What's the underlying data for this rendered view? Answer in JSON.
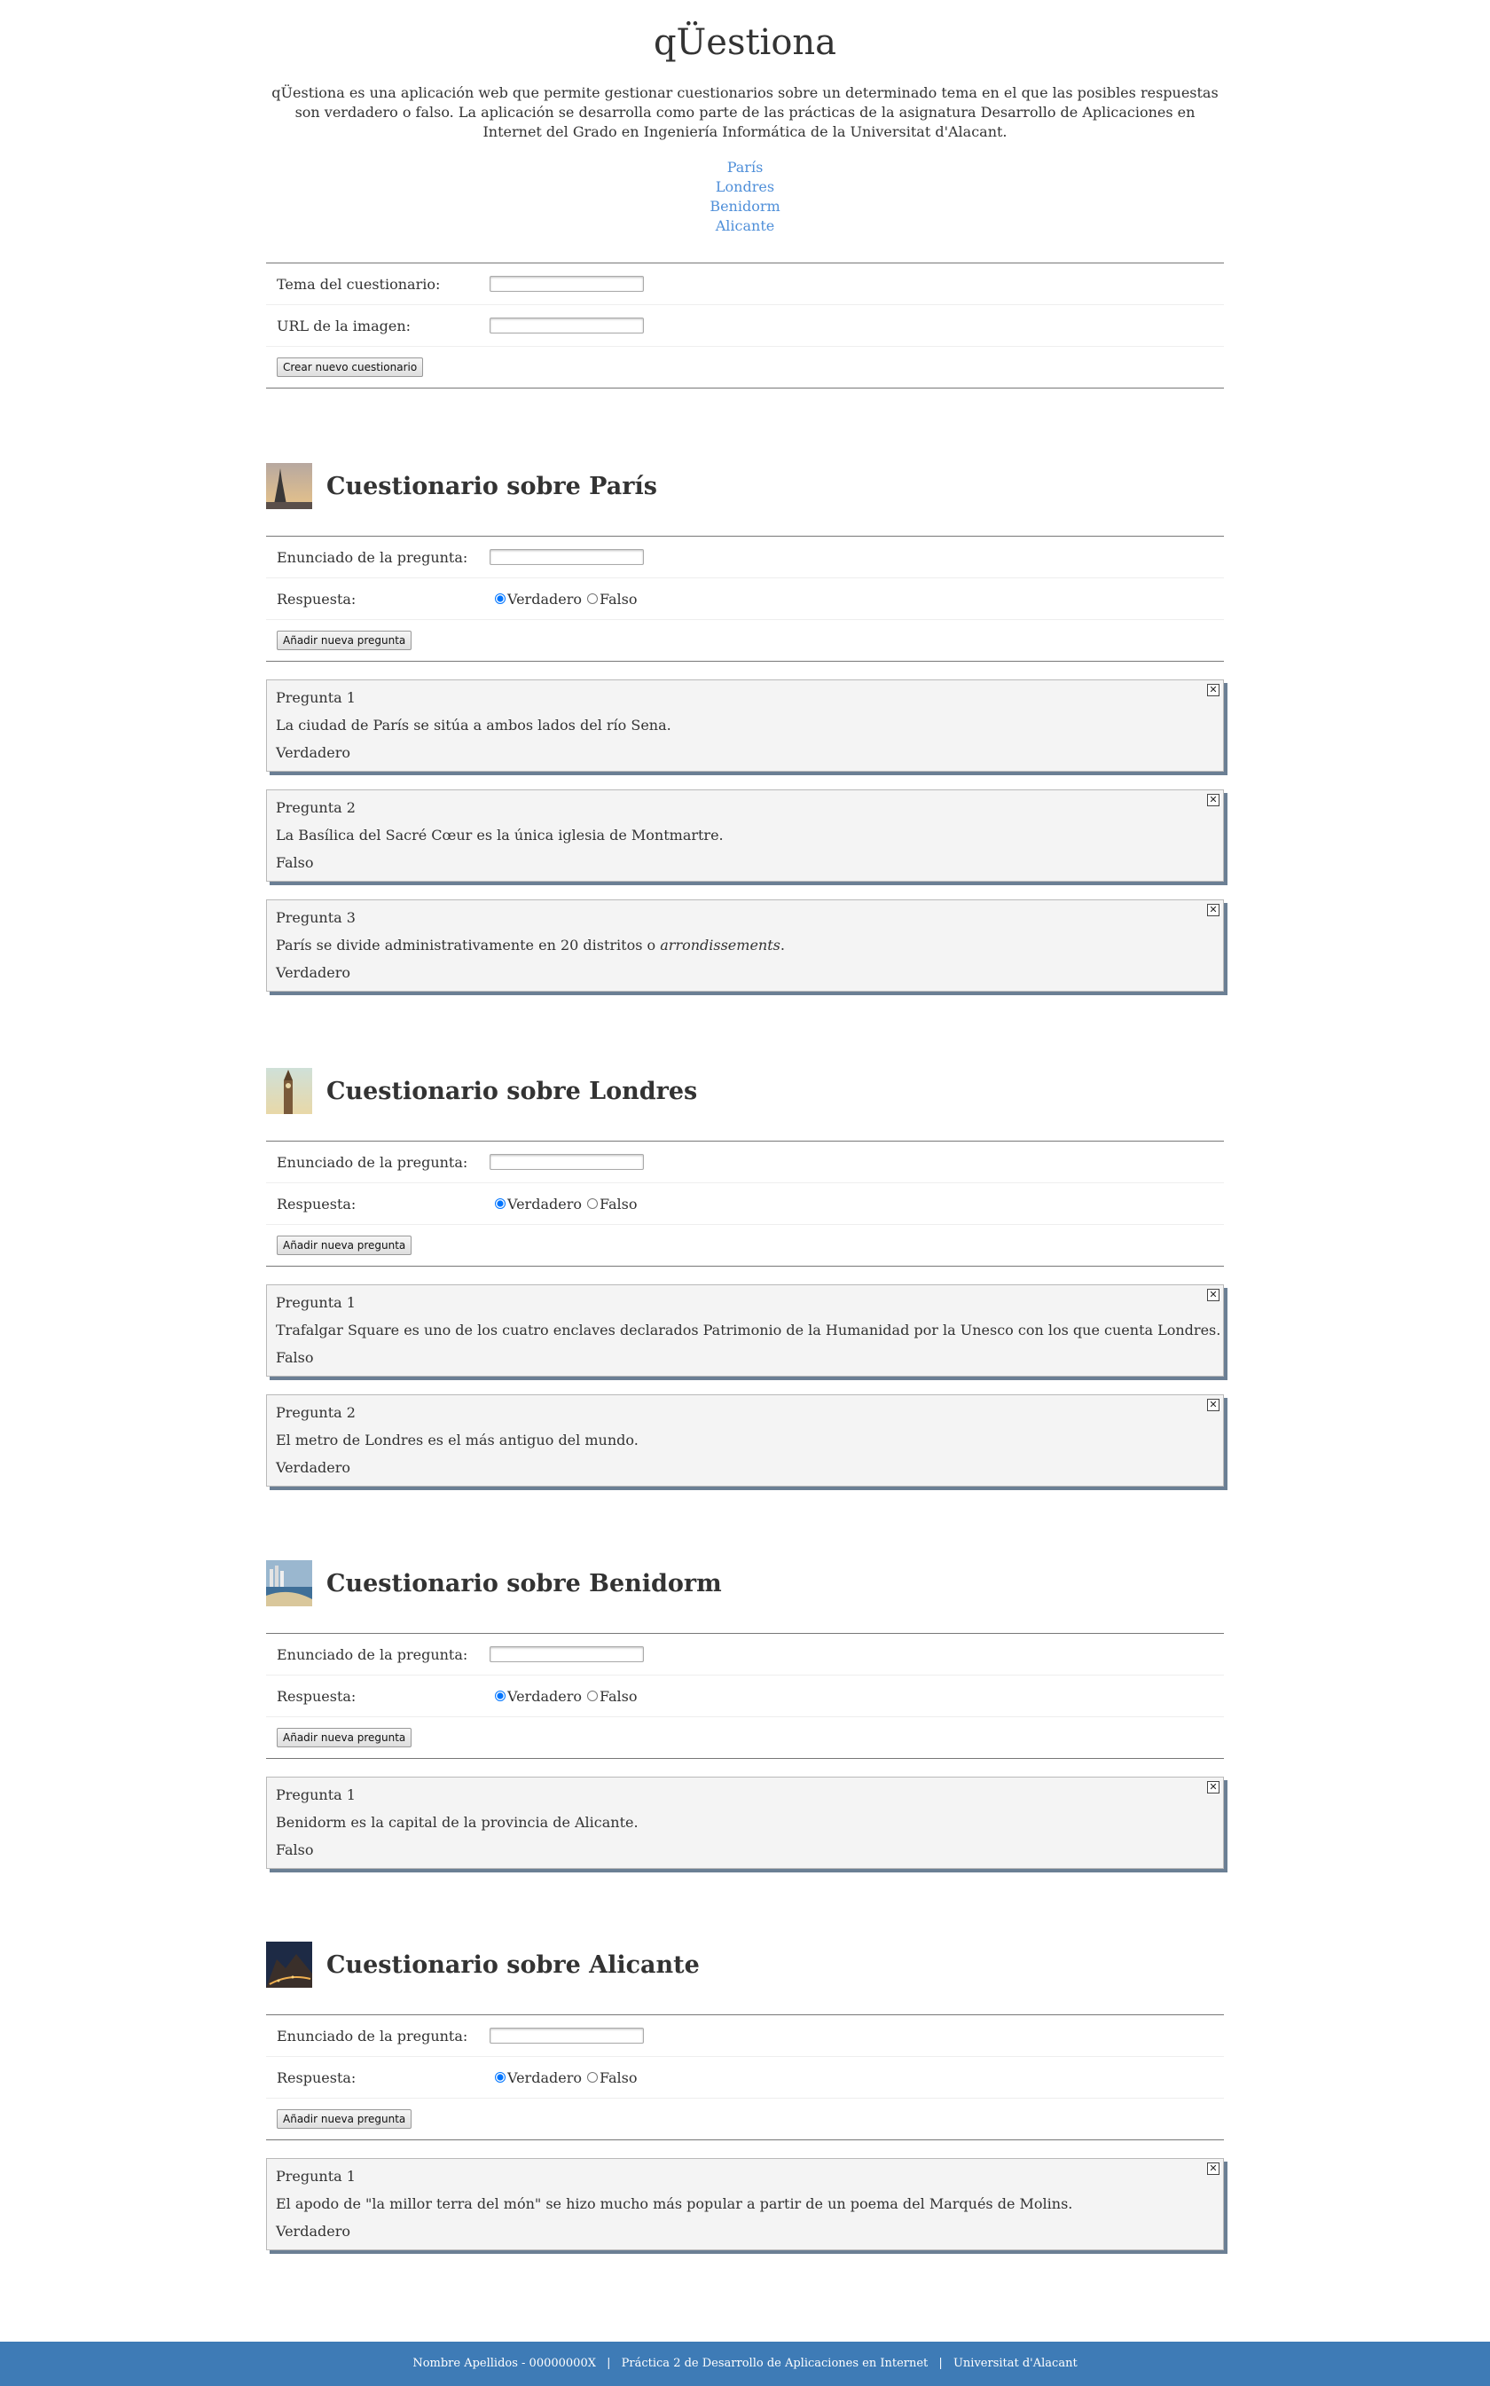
{
  "header": {
    "title": "qÜestiona",
    "intro": "qÜestiona es una aplicación web que permite gestionar cuestionarios sobre un determinado tema en el que las posibles respuestas son verdadero o falso. La aplicación se desarrolla como parte de las prácticas de la asignatura Desarrollo de Aplicaciones en Internet del Grado en Ingeniería Informática de la Universitat d'Alacant."
  },
  "nav": [
    "París",
    "Londres",
    "Benidorm",
    "Alicante"
  ],
  "new_quiz_form": {
    "topic_label": "Tema del cuestionario:",
    "topic_value": "",
    "image_label": "URL de la imagen:",
    "image_value": "",
    "submit_label": "Crear nuevo cuestionario"
  },
  "quizzes": [
    {
      "title": "Cuestionario sobre París",
      "statement_label": "Enunciado de la pregunta:",
      "answer_label": "Respuesta:",
      "true_label": "Verdadero",
      "false_label": "Falso",
      "add_label": "Añadir nueva pregunta",
      "questions": [
        {
          "num": "Pregunta 1",
          "text": "La ciudad de París se sitúa a ambos lados del río Sena.",
          "answer": "Verdadero"
        },
        {
          "num": "Pregunta 2",
          "text": "La Basílica del Sacré Cœur es la única iglesia de Montmartre.",
          "answer": "Falso"
        },
        {
          "num": "Pregunta 3",
          "text_before": "París se divide administrativamente en 20 distritos o ",
          "text_em": "arrondissements",
          "text_after": ".",
          "answer": "Verdadero"
        }
      ]
    },
    {
      "title": "Cuestionario sobre Londres",
      "statement_label": "Enunciado de la pregunta:",
      "answer_label": "Respuesta:",
      "true_label": "Verdadero",
      "false_label": "Falso",
      "add_label": "Añadir nueva pregunta",
      "questions": [
        {
          "num": "Pregunta 1",
          "text": "Trafalgar Square es uno de los cuatro enclaves declarados Patrimonio de la Humanidad por la Unesco con los que cuenta Londres.",
          "answer": "Falso"
        },
        {
          "num": "Pregunta 2",
          "text": "El metro de Londres es el más antiguo del mundo.",
          "answer": "Verdadero"
        }
      ]
    },
    {
      "title": "Cuestionario sobre Benidorm",
      "statement_label": "Enunciado de la pregunta:",
      "answer_label": "Respuesta:",
      "true_label": "Verdadero",
      "false_label": "Falso",
      "add_label": "Añadir nueva pregunta",
      "questions": [
        {
          "num": "Pregunta 1",
          "text": "Benidorm es la capital de la provincia de Alicante.",
          "answer": "Falso"
        }
      ]
    },
    {
      "title": "Cuestionario sobre Alicante",
      "statement_label": "Enunciado de la pregunta:",
      "answer_label": "Respuesta:",
      "true_label": "Verdadero",
      "false_label": "Falso",
      "add_label": "Añadir nueva pregunta",
      "questions": [
        {
          "num": "Pregunta 1",
          "text": "El apodo de \"la millor terra del món\" se hizo mucho más popular a partir de un poema del Marqués de Molins.",
          "answer": "Verdadero"
        }
      ]
    }
  ],
  "footer": {
    "name": "Nombre Apellidos - 00000000X",
    "sep": "|",
    "course": "Práctica 2 de Desarrollo de Aplicaciones en Internet",
    "university": "Universitat d'Alacant"
  },
  "colors": {
    "link": "#4f8fd9",
    "footer_bg": "#3e7bb6",
    "card_shadow": "#6b7f94"
  }
}
